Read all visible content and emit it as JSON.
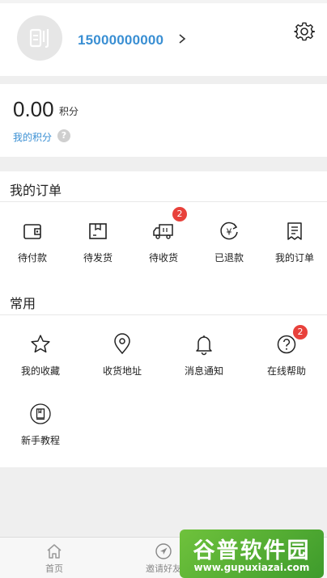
{
  "header": {
    "avatar_glyph": "刨",
    "phone": "15000000000",
    "settings_icon": "gear-icon"
  },
  "points": {
    "value": "0.00",
    "unit": "积分",
    "link": "我的积分",
    "help_glyph": "?"
  },
  "orders": {
    "title": "我的订单",
    "items": [
      {
        "label": "待付款",
        "icon": "wallet-icon",
        "badge": ""
      },
      {
        "label": "待发货",
        "icon": "box-icon",
        "badge": ""
      },
      {
        "label": "待收货",
        "icon": "truck-icon",
        "badge": "2"
      },
      {
        "label": "已退款",
        "icon": "refund-icon",
        "badge": ""
      },
      {
        "label": "我的订单",
        "icon": "order-list-icon",
        "badge": ""
      }
    ]
  },
  "common": {
    "title": "常用",
    "items": [
      {
        "label": "我的收藏",
        "icon": "star-icon",
        "badge": ""
      },
      {
        "label": "收货地址",
        "icon": "location-pin-icon",
        "badge": ""
      },
      {
        "label": "消息通知",
        "icon": "bell-icon",
        "badge": ""
      },
      {
        "label": "在线帮助",
        "icon": "help-circle-icon",
        "badge": "2"
      },
      {
        "label": "新手教程",
        "icon": "book-icon",
        "badge": ""
      }
    ]
  },
  "tabbar": {
    "tabs": [
      {
        "label": "首页",
        "icon": "home-icon"
      },
      {
        "label": "邀请好友",
        "icon": "send-icon"
      }
    ]
  },
  "watermark": {
    "title": "谷普软件园",
    "url": "www.gupuxiazai.com"
  },
  "colors": {
    "accent": "#3a8fd3",
    "badge": "#e8413b",
    "background": "#efefef"
  }
}
